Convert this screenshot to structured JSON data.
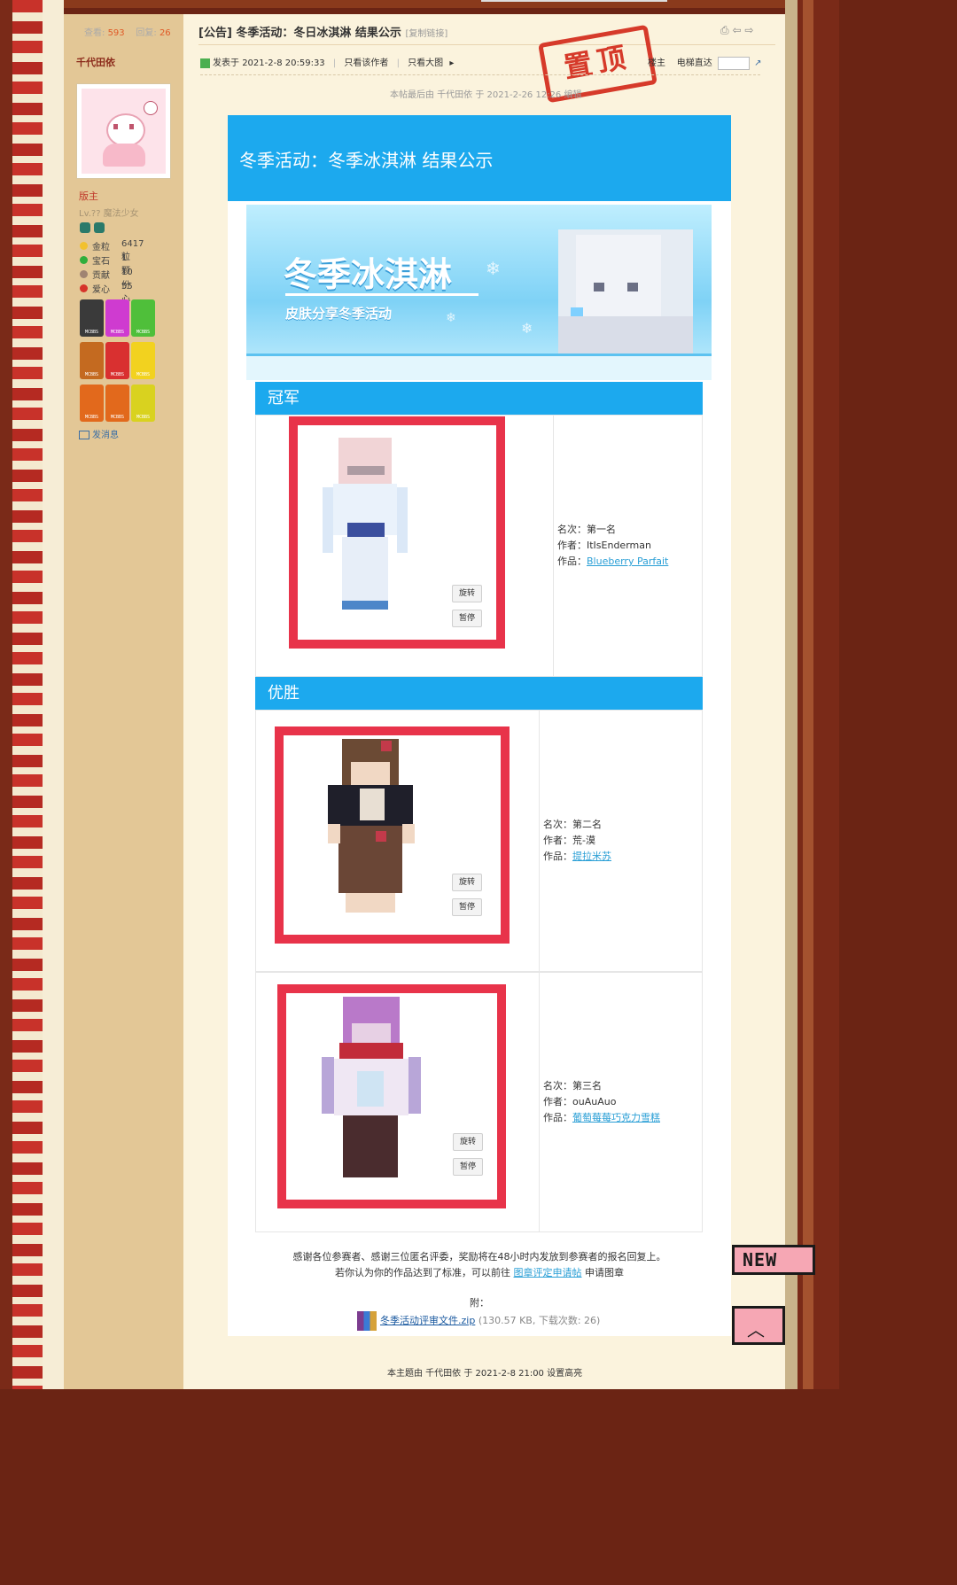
{
  "thread": {
    "views_label": "查看:",
    "views": "593",
    "replies_label": "回复:",
    "replies": "26",
    "title": "[公告] 冬季活动：冬日冰淇淋 结果公示",
    "copy_link": "[复制链接]",
    "stamp": "置顶"
  },
  "author": {
    "name": "千代田依",
    "role": "版主",
    "level": "Lv.?? 魔法少女",
    "stats": [
      {
        "label": "金粒",
        "value": "6417 粒",
        "color": "#f2c12e"
      },
      {
        "label": "宝石",
        "value": "1 颗",
        "color": "#2fae3c"
      },
      {
        "label": "贡献",
        "value": "10 份",
        "color": "#a08472"
      },
      {
        "label": "爱心",
        "value": "55 心",
        "color": "#d6332a"
      }
    ],
    "badge_text": "MCBBS",
    "send_message": "发消息"
  },
  "post": {
    "posted_prefix": "发表于",
    "posted_time": "2021-2-8 20:59:33",
    "only_author": "只看该作者",
    "only_big_image": "只看大图",
    "floor_label": "楼主",
    "elevator_label": "电梯直达",
    "edit_note": "本帖最后由 千代田依 于 2021-2-26 12:26 编辑",
    "header_title": "冬季活动：冬季冰淇淋 结果公示",
    "banner_title": "冬季冰淇淋",
    "banner_subtitle": "皮肤分享冬季活动"
  },
  "sections": {
    "champion": "冠军",
    "winners": "优胜"
  },
  "buttons": {
    "rotate": "旋转",
    "pause": "暂停"
  },
  "entries": [
    {
      "rank_label": "名次：",
      "rank": "第一名",
      "author_label": "作者：",
      "author": "ItIsEnderman",
      "work_label": "作品：",
      "work": "Blueberry Parfait"
    },
    {
      "rank_label": "名次：",
      "rank": "第二名",
      "author_label": "作者：",
      "author": "荒-漠",
      "work_label": "作品：",
      "work": "提拉米苏"
    },
    {
      "rank_label": "名次：",
      "rank": "第三名",
      "author_label": "作者：",
      "author": "ouAuAuo",
      "work_label": "作品：",
      "work": "葡萄莓莓巧克力雪糕"
    }
  ],
  "footer": {
    "thanks": "感谢各位参赛者、感谢三位匿名评委，奖励将在48小时内发放到参赛者的报名回复上。",
    "apply_prefix": "若你认为你的作品达到了标准，可以前往",
    "apply_link": "图章评定申请帖",
    "apply_suffix": "申请图章",
    "attach_label": "附：",
    "attach_file": "冬季活动评审文件.zip",
    "attach_meta": "(130.57 KB, 下载次数: 26)",
    "highlight_note": "本主题由 千代田依 于 2021-2-8 21:00 设置高亮"
  },
  "side_tags": {
    "new": "NEW"
  },
  "colors": {
    "accent_blue": "#1ca9ee",
    "frame_red": "#e8334a",
    "stamp_red": "#d63a2a"
  }
}
